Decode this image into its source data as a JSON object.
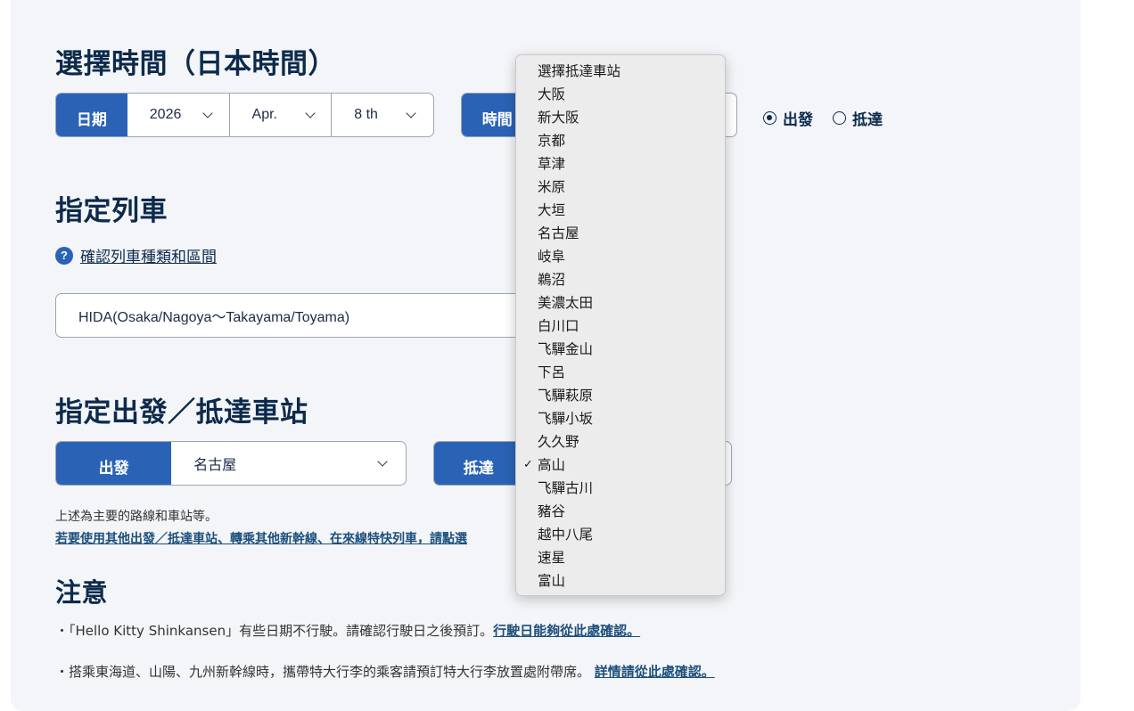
{
  "time_section": {
    "title": "選擇時間（日本時間）",
    "date_label": "日期",
    "year": "2026",
    "month": "Apr.",
    "day": "8 th",
    "time_label": "時間",
    "departure_radio": "出發",
    "arrival_radio": "抵達",
    "selected_radio": "departure"
  },
  "train_section": {
    "title": "指定列車",
    "help_link": "確認列車種類和區間",
    "train_value": "HIDA(Osaka/Nagoya～Takayama/Toyama)"
  },
  "station_section": {
    "title": "指定出發／抵達車站",
    "departure_label": "出發",
    "departure_value": "名古屋",
    "arrival_label": "抵達",
    "note": "上述為主要的路線和車站等。",
    "link": "若要使用其他出發／抵達車站、轉乘其他新幹線、在來線特快列車，請點選"
  },
  "notes_section": {
    "title": "注意",
    "note1_text": "・「Hello Kitty Shinkansen」有些日期不行駛。請確認行駛日之後預訂。",
    "note1_link": "行駛日能夠從此處確認。",
    "note2_text": "・搭乘東海道、山陽、九州新幹線時，攜帶特大行李的乘客請預訂特大行李放置處附帶席。 ",
    "note2_link": "詳情請從此處確認。"
  },
  "arrival_dropdown": {
    "selected": "高山",
    "check_glyph": "✓",
    "options": [
      "選擇抵達車站",
      "大阪",
      "新大阪",
      "京都",
      "草津",
      "米原",
      "大垣",
      "名古屋",
      "岐阜",
      "鵜沼",
      "美濃太田",
      "白川口",
      "飞驒金山",
      "下呂",
      "飞驒萩原",
      "飞驒小坂",
      "久久野",
      "高山",
      "飞驒古川",
      "豬谷",
      "越中八尾",
      "速星",
      "富山"
    ]
  },
  "colors": {
    "accent": "#2a63b6",
    "heading": "#0d2a4c",
    "link": "#1d4f7c",
    "panel_bg": "#f3f5f8"
  },
  "icons": {
    "help": "question-circle-icon",
    "dropdown": "chevron-down-icon",
    "selected_option": "checkmark-icon"
  }
}
